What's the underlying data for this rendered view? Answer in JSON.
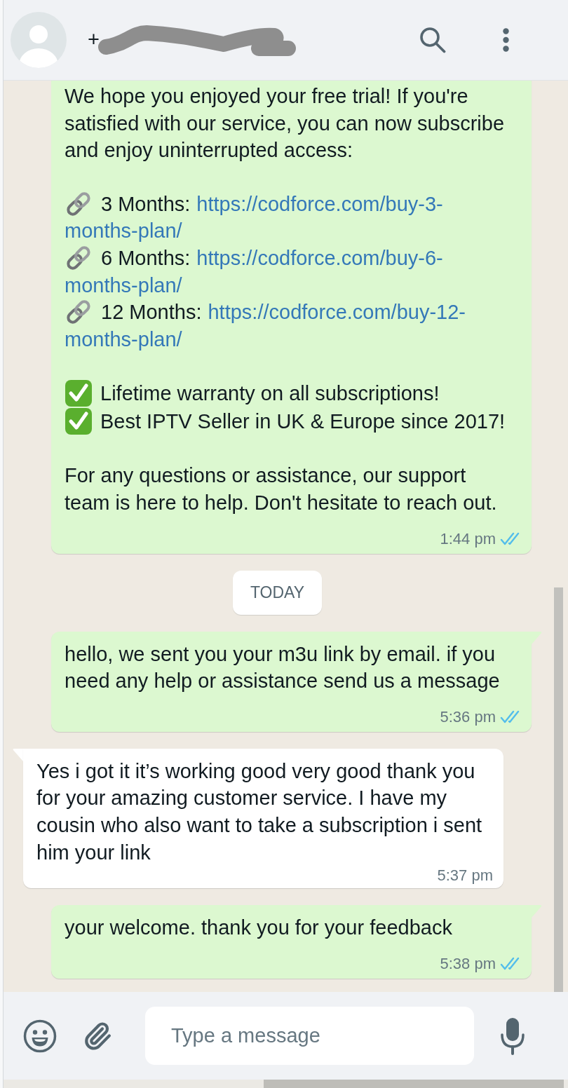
{
  "header": {
    "contact": {
      "name": "+",
      "redacted": true
    }
  },
  "chat": [
    {
      "kind": "message",
      "outgoing": true,
      "tail": false,
      "blocks": [
        {
          "kind": "paragraph",
          "text": "We hope you enjoyed your free trial! If you're satisfied with our service, you can now subscribe and enjoy uninterrupted access:"
        },
        {
          "kind": "plans",
          "items": [
            {
              "label": "3 Months:",
              "url_lines": [
                "https://codforce.com/buy-3-",
                "months-plan/"
              ]
            },
            {
              "label": "6 Months:",
              "url_lines": [
                "https://codforce.com/buy-6-",
                "months-plan/"
              ]
            },
            {
              "label": "12 Months:",
              "url_lines": [
                "https://codforce.com/buy-12-",
                "months-plan/"
              ]
            }
          ]
        },
        {
          "kind": "checklist",
          "items": [
            "Lifetime warranty on all subscriptions!",
            "Best IPTV Seller in UK & Europe since 2017!"
          ]
        },
        {
          "kind": "paragraph",
          "text": "For any questions or assistance, our support team is here to help. Don't hesitate to reach out."
        }
      ],
      "time": "1:44 pm",
      "read": true
    },
    {
      "kind": "date_divider",
      "label": "TODAY"
    },
    {
      "kind": "message",
      "outgoing": true,
      "tail": true,
      "blocks": [
        {
          "kind": "paragraph",
          "text": "hello, we sent you your m3u link by email. if you need any help or assistance send us a message"
        }
      ],
      "time": "5:36 pm",
      "read": true
    },
    {
      "kind": "message",
      "outgoing": false,
      "tail": true,
      "blocks": [
        {
          "kind": "paragraph",
          "text": "Yes i got it it’s working good very good thank you for your amazing customer service. I have my cousin who also want to take a subscription i sent him your link"
        }
      ],
      "time": "5:37 pm"
    },
    {
      "kind": "message",
      "outgoing": true,
      "tail": true,
      "blocks": [
        {
          "kind": "paragraph",
          "text": "your welcome. thank you for your feedback"
        }
      ],
      "time": "5:38 pm",
      "read": true
    }
  ],
  "composer": {
    "placeholder": "Type a message"
  }
}
